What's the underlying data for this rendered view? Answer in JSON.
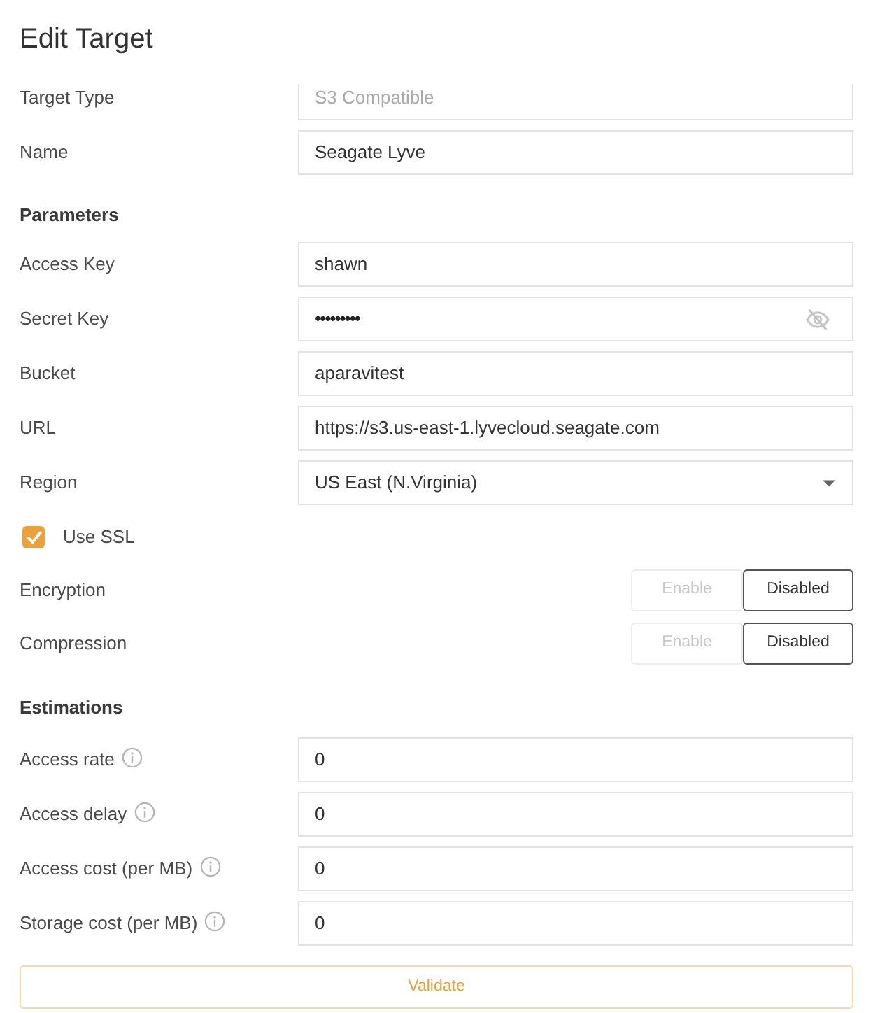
{
  "title": "Edit Target",
  "general": [
    {
      "label": "Target Type",
      "value": "S3 Compatible",
      "disabled": true
    },
    {
      "label": "Name",
      "value": "Seagate Lyve",
      "disabled": false
    }
  ],
  "sections": [
    {
      "heading": "Parameters",
      "rows": [
        {
          "kind": "text",
          "label": "Access Key",
          "value": "shawn"
        },
        {
          "kind": "password",
          "label": "Secret Key",
          "value": "•••••••••"
        },
        {
          "kind": "text",
          "label": "Bucket",
          "value": "aparavitest"
        },
        {
          "kind": "text",
          "label": "URL",
          "value": "https://s3.us-east-1.lyvecloud.seagate.com"
        },
        {
          "kind": "select",
          "label": "Region",
          "value": "US East (N.Virginia)"
        },
        {
          "kind": "checkbox",
          "label": "Use SSL",
          "checked": true
        },
        {
          "kind": "toggle",
          "label": "Encryption",
          "options": [
            {
              "label": "Enable",
              "selected": false
            },
            {
              "label": "Disabled",
              "selected": true
            }
          ]
        },
        {
          "kind": "toggle",
          "label": "Compression",
          "options": [
            {
              "label": "Enable",
              "selected": false
            },
            {
              "label": "Disabled",
              "selected": true
            }
          ]
        }
      ]
    },
    {
      "heading": "Estimations",
      "rows": [
        {
          "kind": "hinted",
          "label": "Access rate",
          "value": "0"
        },
        {
          "kind": "hinted",
          "label": "Access delay",
          "value": "0"
        },
        {
          "kind": "hinted",
          "label": "Access cost (per MB)",
          "value": "0"
        },
        {
          "kind": "hinted",
          "label": "Storage cost (per MB)",
          "value": "0"
        }
      ]
    }
  ],
  "validate_button": "Validate"
}
